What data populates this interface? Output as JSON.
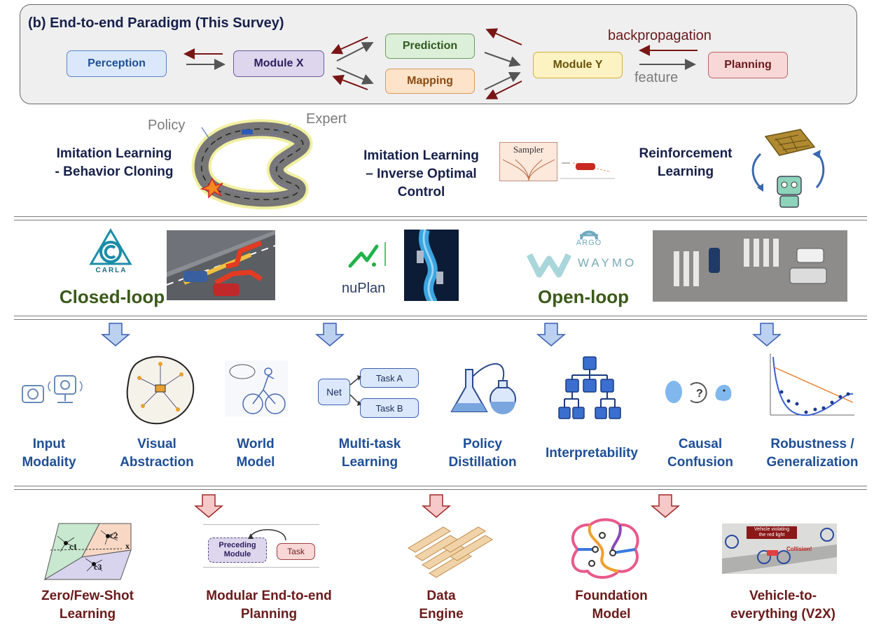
{
  "paradigm": {
    "title": "(b) End-to-end Paradigm (This Survey)",
    "modules": {
      "perception": "Perception",
      "module_x": "Module X",
      "prediction": "Prediction",
      "mapping": "Mapping",
      "module_y": "Module Y",
      "planning": "Planning"
    },
    "backprop_label": "backpropagation",
    "feature_label": "feature",
    "colors": {
      "perception": "#dbe8fb",
      "module_x": "#ddd6ec",
      "prediction": "#dcefd8",
      "mapping": "#fce3c9",
      "module_y": "#fdf2c2",
      "planning": "#f8d7d7",
      "backprop_arrow": "#7a1515",
      "feature_arrow": "#555555"
    }
  },
  "learning": {
    "policy_label": "Policy",
    "expert_label": "Expert",
    "sampler_label": "Sampler",
    "bc_line1": "Imitation Learning",
    "bc_line2": "- Behavior Cloning",
    "ioc_line1": "Imitation Learning",
    "ioc_line2": "– Inverse Optimal",
    "ioc_line3": "Control",
    "rl_line1": "Reinforcement",
    "rl_line2": "Learning"
  },
  "benchmarks": {
    "carla_logo": "CARLA",
    "nuplan_logo": "nuPlan",
    "argo_logo": "ARGO",
    "waymo_logo": "WAYMO",
    "closed_loop": "Closed-loop",
    "open_loop": "Open-loop"
  },
  "challenges": {
    "net_label": "Net",
    "task_a": "Task A",
    "task_b": "Task B",
    "items": [
      {
        "line1": "Input",
        "line2": "Modality"
      },
      {
        "line1": "Visual",
        "line2": "Abstraction"
      },
      {
        "line1": "World",
        "line2": "Model"
      },
      {
        "line1": "Multi-task",
        "line2": "Learning"
      },
      {
        "line1": "Policy",
        "line2": "Distillation"
      },
      {
        "line1": "Interpretability",
        "line2": ""
      },
      {
        "line1": "Causal",
        "line2": "Confusion"
      },
      {
        "line1": "Robustness /",
        "line2": "Generalization"
      }
    ]
  },
  "future": {
    "c1": "c1",
    "c2": "c2",
    "c3": "c3",
    "x_label": "x",
    "preceding_line1": "Preceding",
    "preceding_line2": "Module",
    "task_label": "Task",
    "v2x_banner_line1": "Vehicle violating",
    "v2x_banner_line2": "the red light",
    "v2x_collision": "Collision!",
    "items": [
      {
        "line1": "Zero/Few-Shot",
        "line2": "Learning"
      },
      {
        "line1": "Modular End-to-end",
        "line2": "Planning"
      },
      {
        "line1": "Data",
        "line2": "Engine"
      },
      {
        "line1": "Foundation",
        "line2": "Model"
      },
      {
        "line1": "Vehicle-to-",
        "line2": "everything (V2X)"
      }
    ]
  }
}
